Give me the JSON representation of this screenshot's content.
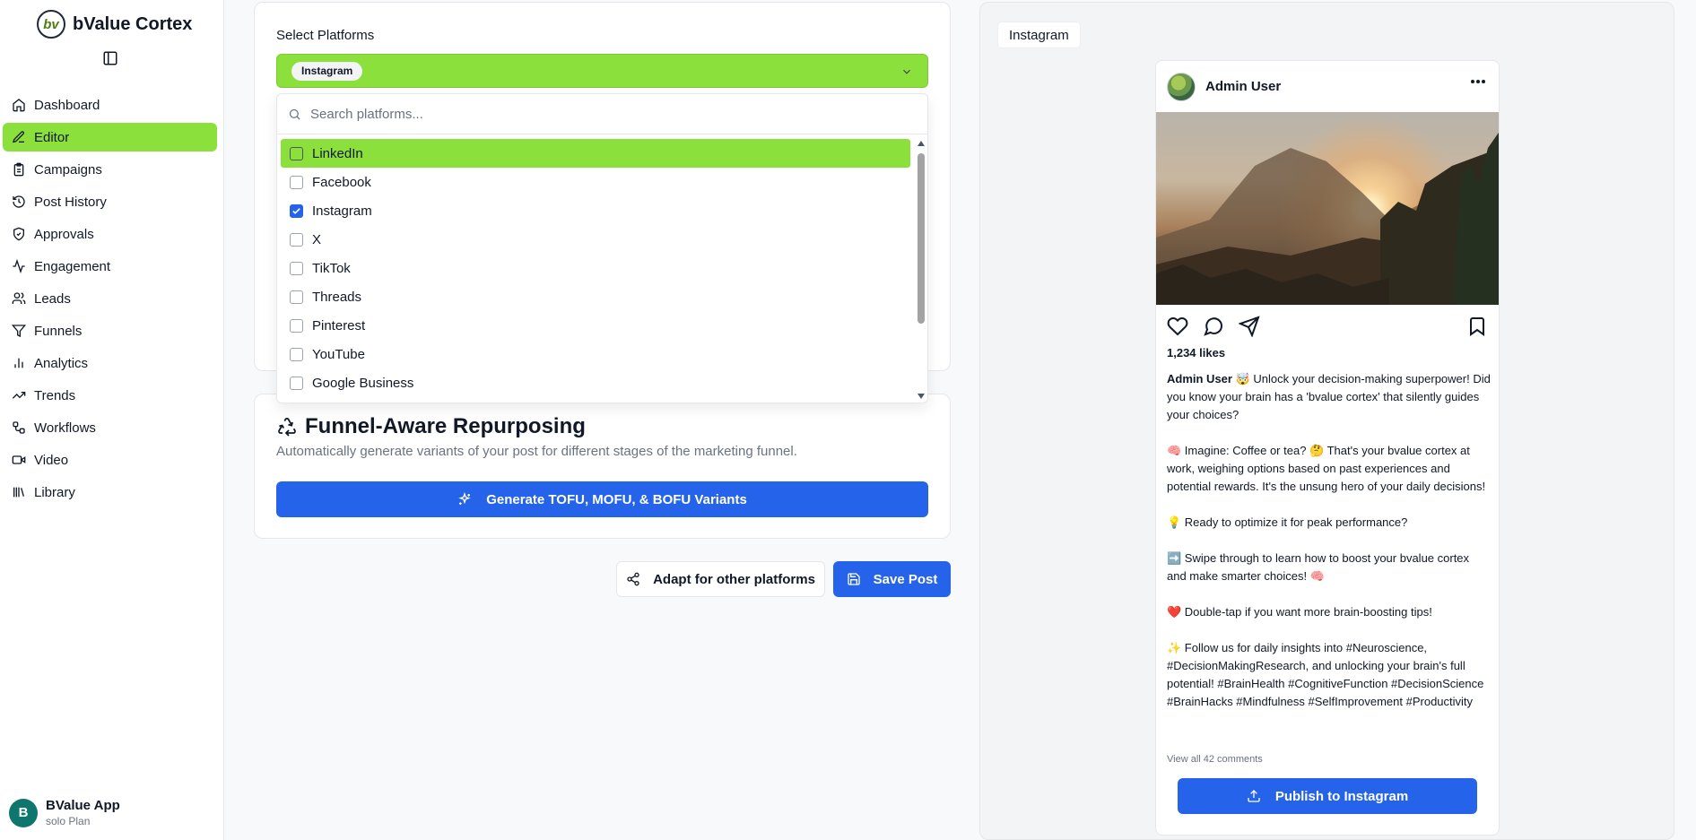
{
  "app": {
    "name": "bValue Cortex",
    "logo_text": "bv"
  },
  "sidebar": {
    "items": [
      {
        "label": "Dashboard",
        "icon": "home-icon"
      },
      {
        "label": "Editor",
        "icon": "edit-icon",
        "active": true
      },
      {
        "label": "Campaigns",
        "icon": "clipboard-icon"
      },
      {
        "label": "Post History",
        "icon": "history-icon"
      },
      {
        "label": "Approvals",
        "icon": "shield-check-icon"
      },
      {
        "label": "Engagement",
        "icon": "activity-icon"
      },
      {
        "label": "Leads",
        "icon": "users-icon"
      },
      {
        "label": "Funnels",
        "icon": "filter-icon"
      },
      {
        "label": "Analytics",
        "icon": "bar-chart-icon"
      },
      {
        "label": "Trends",
        "icon": "trending-up-icon"
      },
      {
        "label": "Workflows",
        "icon": "workflow-icon"
      },
      {
        "label": "Video",
        "icon": "video-icon"
      },
      {
        "label": "Library",
        "icon": "library-icon"
      }
    ],
    "user": {
      "initial": "B",
      "name": "BValue App",
      "plan": "solo Plan"
    }
  },
  "platforms": {
    "label": "Select Platforms",
    "selected_chip": "Instagram",
    "search_placeholder": "Search platforms...",
    "options": [
      {
        "label": "LinkedIn",
        "checked": false,
        "highlighted": true
      },
      {
        "label": "Facebook",
        "checked": false
      },
      {
        "label": "Instagram",
        "checked": true
      },
      {
        "label": "X",
        "checked": false
      },
      {
        "label": "TikTok",
        "checked": false
      },
      {
        "label": "Threads",
        "checked": false
      },
      {
        "label": "Pinterest",
        "checked": false
      },
      {
        "label": "YouTube",
        "checked": false
      },
      {
        "label": "Google Business",
        "checked": false
      }
    ]
  },
  "funnel": {
    "title": "Funnel-Aware Repurposing",
    "description": "Automatically generate variants of your post for different stages of the marketing funnel.",
    "generate_label": "Generate TOFU, MOFU, & BOFU Variants"
  },
  "actions": {
    "adapt_label": "Adapt for other platforms",
    "save_label": "Save Post"
  },
  "preview": {
    "tab_label": "Instagram",
    "username": "Admin User",
    "likes": "1,234 likes",
    "caption_user": "Admin User",
    "caption_text": " 🤯 Unlock your decision-making superpower! Did you know your brain has a 'bvalue cortex' that silently guides your choices?\n\n🧠 Imagine: Coffee or tea? 🤔 That's your bvalue cortex at work, weighing options based on past experiences and potential rewards. It's the unsung hero of your daily decisions!\n\n💡 Ready to optimize it for peak performance?\n\n➡️ Swipe through to learn how to boost your bvalue cortex and make smarter choices! 🧠\n\n❤️ Double-tap if you want more brain-boosting tips!\n\n✨ Follow us for daily insights into #Neuroscience, #DecisionMakingResearch, and unlocking your brain's full potential! #BrainHealth #CognitiveFunction #DecisionScience #BrainHacks #Mindfulness #SelfImprovement #Productivity",
    "comments_link": "View all 42 comments",
    "publish_label": "Publish to Instagram"
  },
  "colors": {
    "accent_green": "#8ce03b",
    "primary_blue": "#2563eb"
  }
}
